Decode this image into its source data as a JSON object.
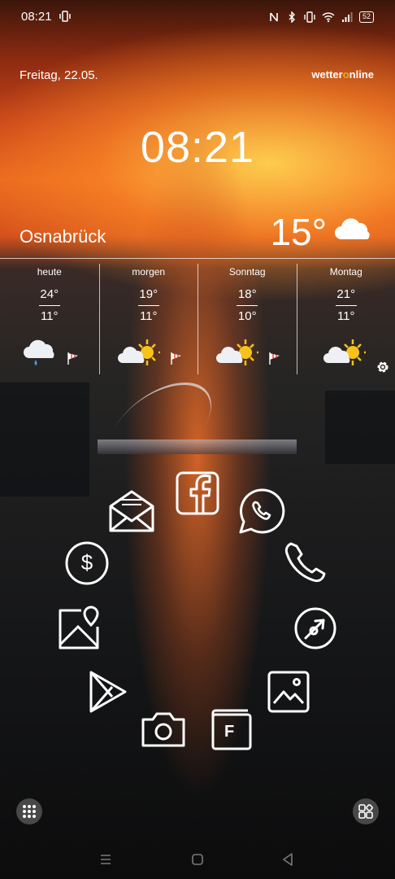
{
  "status_bar": {
    "time": "08:21",
    "battery": "52",
    "icons": [
      "vibrate-icon",
      "nfc-icon",
      "bluetooth-icon",
      "vibrate-icon",
      "wifi-icon",
      "signal-icon",
      "battery-icon"
    ]
  },
  "widget": {
    "date": "Freitag, 22.05.",
    "brand_prefix": "wetter",
    "brand_o": "o",
    "brand_suffix": "nline",
    "clock": "08:21",
    "city": "Osnabrück",
    "current_temp": "15°",
    "current_icon": "cloud-icon",
    "forecast": [
      {
        "day": "heute",
        "max": "24°",
        "min": "11°",
        "icon": "cloud-rain-icon"
      },
      {
        "day": "morgen",
        "max": "19°",
        "min": "11°",
        "icon": "partly-sunny-icon"
      },
      {
        "day": "Sonntag",
        "max": "18°",
        "min": "10°",
        "icon": "partly-sunny-icon"
      },
      {
        "day": "Montag",
        "max": "21°",
        "min": "11°",
        "icon": "partly-sunny-icon"
      }
    ]
  },
  "apps": [
    {
      "name": "facebook",
      "icon": "facebook-icon"
    },
    {
      "name": "whatsapp",
      "icon": "whatsapp-icon"
    },
    {
      "name": "phone",
      "icon": "phone-icon"
    },
    {
      "name": "browser",
      "icon": "browser-icon"
    },
    {
      "name": "gallery",
      "icon": "gallery-icon"
    },
    {
      "name": "files",
      "icon": "files-icon"
    },
    {
      "name": "camera",
      "icon": "camera-icon"
    },
    {
      "name": "play-store",
      "icon": "play-store-icon"
    },
    {
      "name": "maps",
      "icon": "map-icon"
    },
    {
      "name": "payment",
      "icon": "dollar-icon"
    },
    {
      "name": "email",
      "icon": "mail-icon"
    }
  ],
  "files_letter": "F",
  "payment_symbol": "$",
  "colors": {
    "accent": "#f5a623",
    "sun": "#f7c21a",
    "rain": "#3aa0e8"
  }
}
